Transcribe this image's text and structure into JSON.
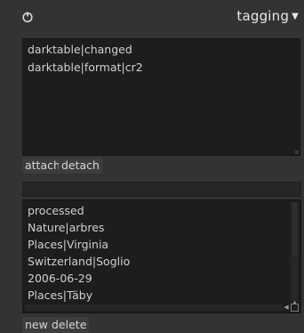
{
  "header": {
    "title": "tagging",
    "power_icon": "power-icon",
    "collapse_icon": "triangle-down-icon",
    "collapse_glyph": "▼"
  },
  "attached_tags": {
    "items": [
      "darktable|changed",
      "darktable|format|cr2"
    ]
  },
  "attached_actions": {
    "attach_label": "attach",
    "detach_label": "detach"
  },
  "tag_entry": {
    "value": ""
  },
  "dictionary": {
    "items": [
      "processed",
      "Nature|arbres",
      "Places|Virginia",
      "Switzerland|Soglio",
      "2006-06-29",
      "Places|Täby"
    ]
  },
  "dictionary_actions": {
    "new_label": "new",
    "delete_label": "delete"
  },
  "colors": {
    "panel_bg": "#333333",
    "list_bg": "#1d1d1d",
    "text": "#d0d0d0"
  }
}
